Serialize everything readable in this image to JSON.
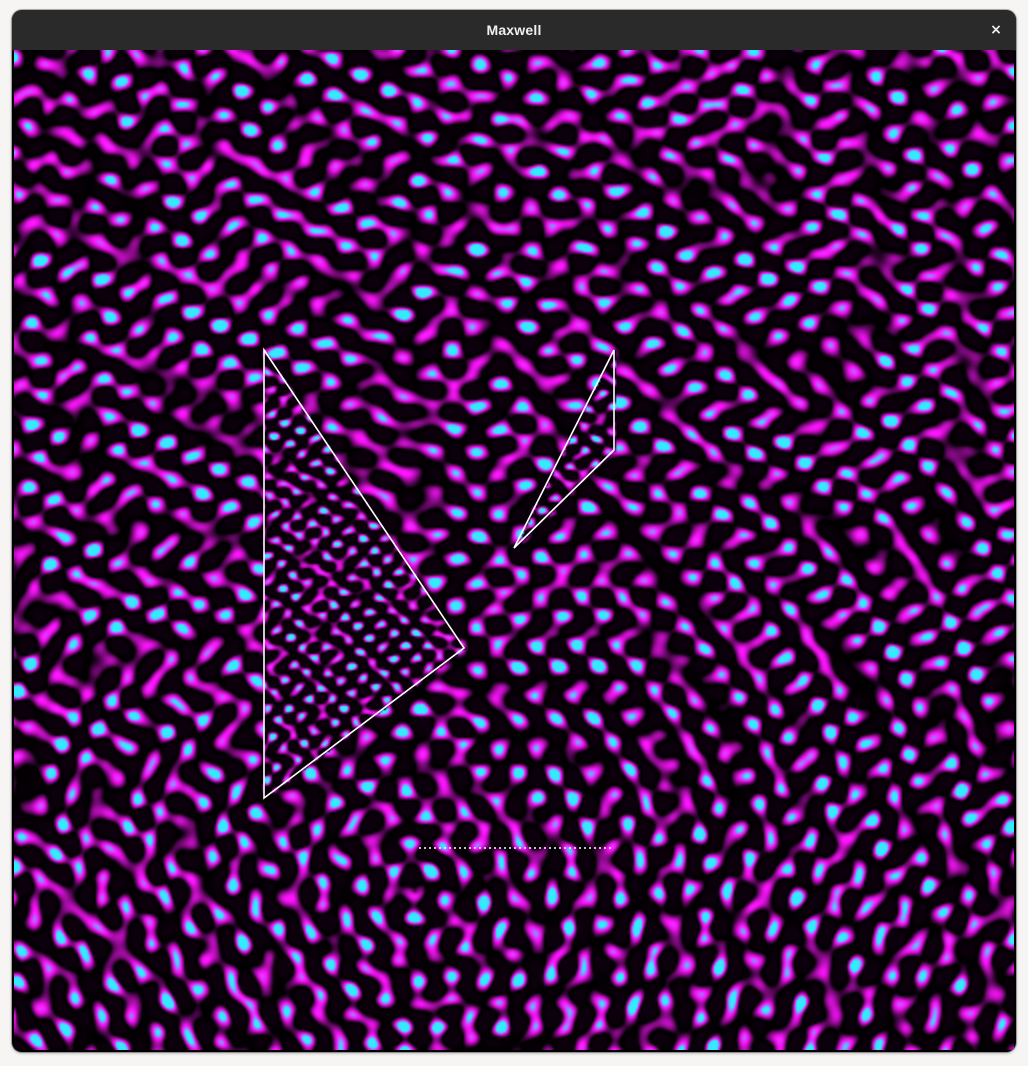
{
  "window": {
    "title": "Maxwell",
    "close_icon": "close-icon",
    "close_glyph": "×"
  },
  "simulation": {
    "colors": {
      "field_positive": "#ff22ff",
      "field_peak": "#33eeff",
      "background": "#000000",
      "obstacle_outline": "#ffffff",
      "titlebar": "#2a2a2a"
    },
    "obstacles": [
      {
        "name": "large-triangle-prism"
      },
      {
        "name": "small-triangle-prism"
      },
      {
        "name": "dotted-barrier-line"
      }
    ]
  }
}
